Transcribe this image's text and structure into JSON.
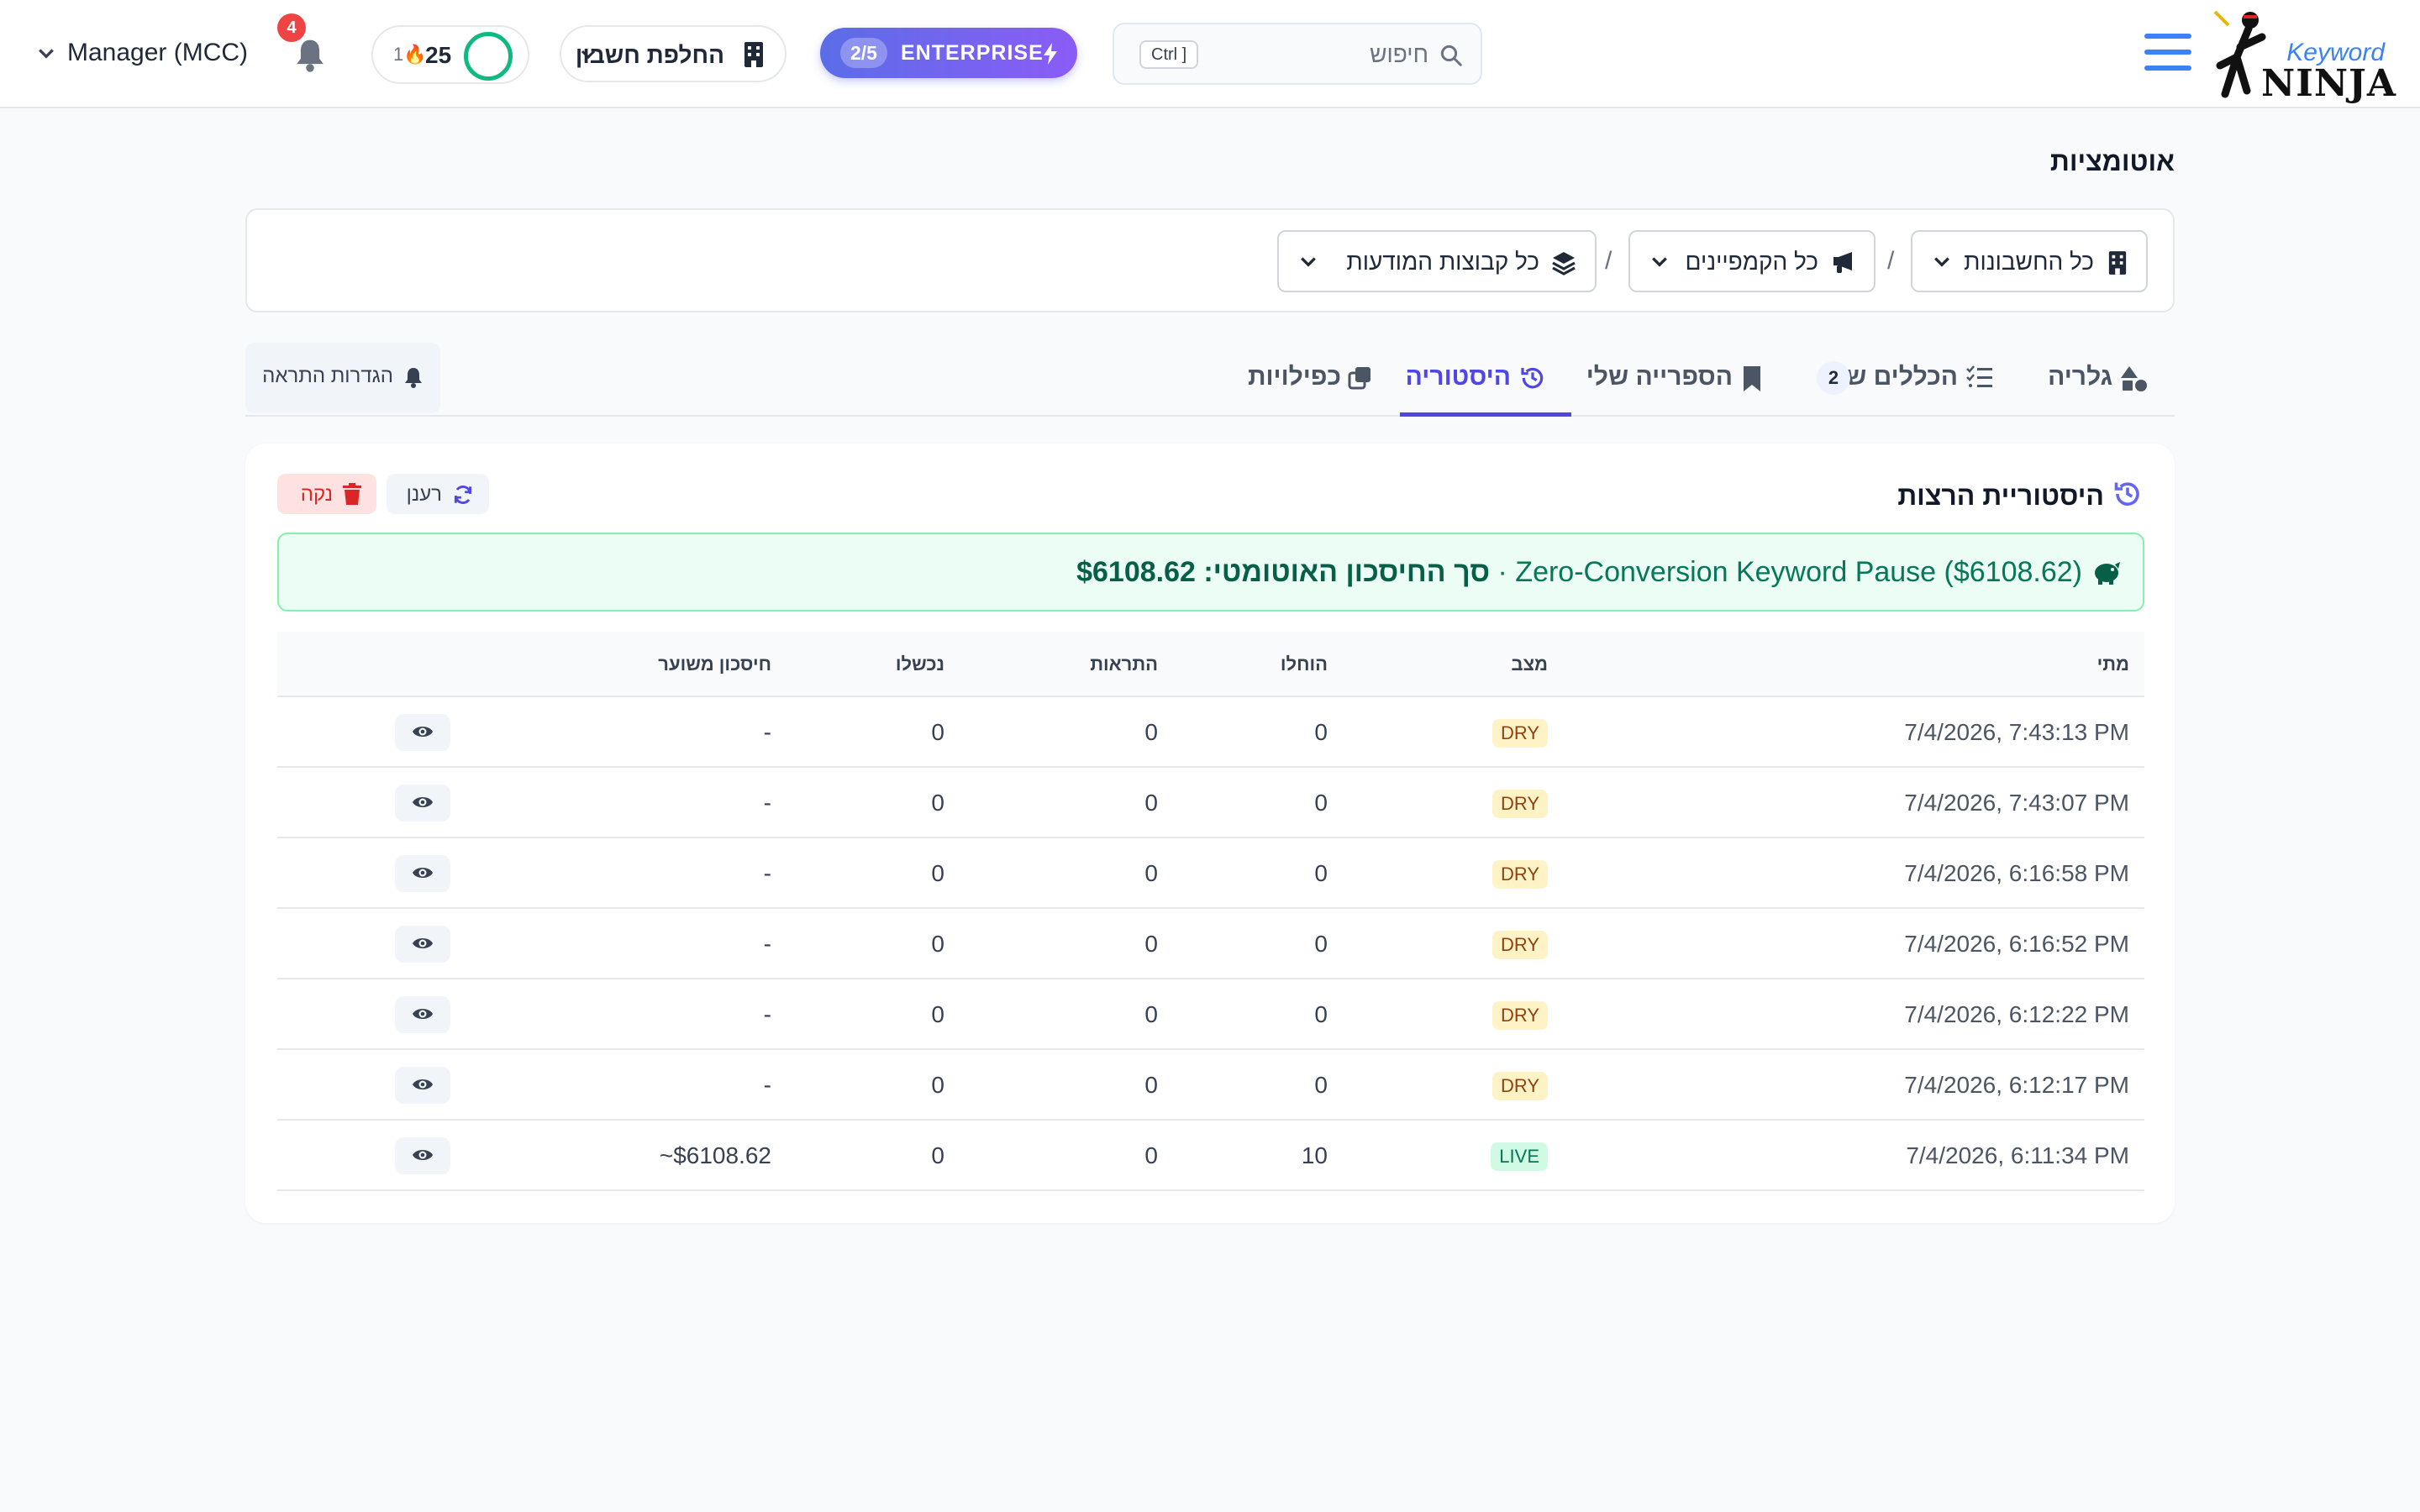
{
  "header": {
    "logo_text_top": "Keyword",
    "logo_text_bottom": "NINJA",
    "search_placeholder": "חיפוש",
    "search_shortcut": "Ctrl ]",
    "plan_label": "ENTERPRISE",
    "plan_usage": "2/5",
    "switch_account_label": "החלפת חשבון",
    "credits_value": "25",
    "streak_value": "1",
    "notifications_count": "4",
    "account_label": "Manager (MCC)"
  },
  "page": {
    "title": "אוטומציות"
  },
  "filters": {
    "accounts": "כל החשבונות",
    "campaigns": "כל הקמפיינים",
    "ad_groups": "כל קבוצות המודעות",
    "separator": "/"
  },
  "tabs": [
    {
      "label": "גלריה"
    },
    {
      "label": "הכללים שלי",
      "count": "2"
    },
    {
      "label": "הספרייה שלי"
    },
    {
      "label": "היסטוריה"
    },
    {
      "label": "כפילויות"
    }
  ],
  "alert_settings_label": "הגדרות התראה",
  "history": {
    "title": "היסטוריית הרצות",
    "refresh_label": "רענן",
    "clear_label": "נקה",
    "savings_prefix": "סך החיסכון האוטומטי: $6108.62",
    "savings_detail": " · Zero-Conversion Keyword Pause ($6108.62)",
    "columns": {
      "when": "מתי",
      "status": "מצב",
      "applied": "הוחלו",
      "alerts": "התראות",
      "failed": "נכשלו",
      "est_savings": "חיסכון משוער"
    },
    "rows": [
      {
        "when": "7/4/2026, 7:43:13 PM",
        "status": "DRY",
        "applied": "0",
        "alerts": "0",
        "failed": "0",
        "savings": "-"
      },
      {
        "when": "7/4/2026, 7:43:07 PM",
        "status": "DRY",
        "applied": "0",
        "alerts": "0",
        "failed": "0",
        "savings": "-"
      },
      {
        "when": "7/4/2026, 6:16:58 PM",
        "status": "DRY",
        "applied": "0",
        "alerts": "0",
        "failed": "0",
        "savings": "-"
      },
      {
        "when": "7/4/2026, 6:16:52 PM",
        "status": "DRY",
        "applied": "0",
        "alerts": "0",
        "failed": "0",
        "savings": "-"
      },
      {
        "when": "7/4/2026, 6:12:22 PM",
        "status": "DRY",
        "applied": "0",
        "alerts": "0",
        "failed": "0",
        "savings": "-"
      },
      {
        "when": "7/4/2026, 6:12:17 PM",
        "status": "DRY",
        "applied": "0",
        "alerts": "0",
        "failed": "0",
        "savings": "-"
      },
      {
        "when": "7/4/2026, 6:11:34 PM",
        "status": "LIVE",
        "applied": "10",
        "alerts": "0",
        "failed": "0",
        "savings": "~$6108.62"
      }
    ]
  },
  "colors": {
    "accent": "#4f46e5",
    "brand_blue": "#3b82f6",
    "success": "#047857",
    "danger": "#dc2626"
  }
}
